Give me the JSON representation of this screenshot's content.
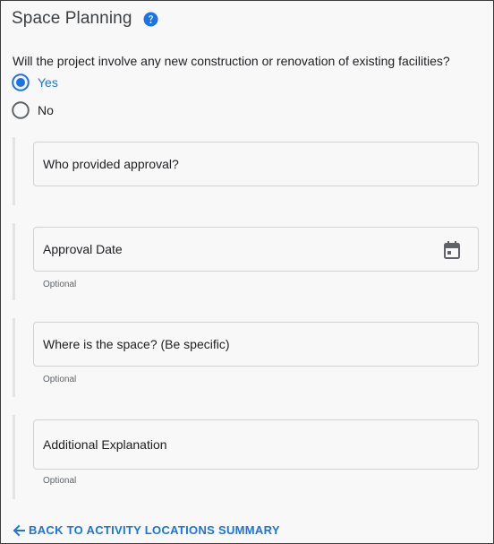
{
  "section": {
    "title": "Space Planning",
    "help_icon": "help-circle-icon"
  },
  "question": {
    "text": "Will the project involve any new construction or renovation of existing facilities?",
    "options": [
      {
        "label": "Yes",
        "selected": true
      },
      {
        "label": "No",
        "selected": false
      }
    ]
  },
  "fields": [
    {
      "label": "Who provided approval?",
      "hint": ""
    },
    {
      "label": "Approval Date",
      "hint": "Optional",
      "icon": "calendar-icon"
    },
    {
      "label": "Where is the space? (Be specific)",
      "hint": "Optional"
    },
    {
      "label": "Additional Explanation",
      "hint": "Optional"
    }
  ],
  "footer": {
    "back_label": "BACK TO ACTIVITY LOCATIONS SUMMARY",
    "icon": "arrow-left-icon"
  },
  "colors": {
    "accent": "#1a73e8",
    "border": "#d2d2d2",
    "section_bar": "#e3e3e3"
  }
}
